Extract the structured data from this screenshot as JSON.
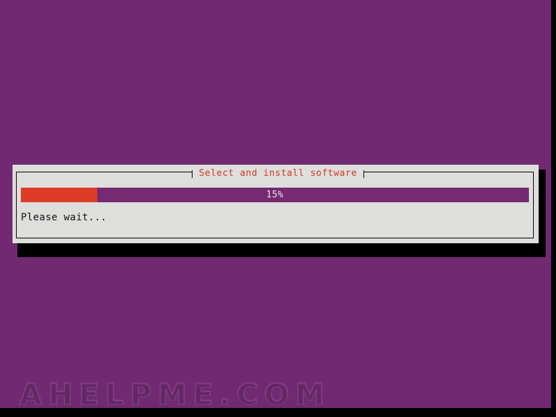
{
  "screen": {
    "background_color": "#712a72",
    "gutter_color": "#000000",
    "watermark": "AHELPME.COM"
  },
  "dialog": {
    "title": "Select and install software",
    "title_color": "#cc3a2a",
    "background_color": "#dededc",
    "border_color": "#000000",
    "shadow_color": "#000000",
    "status_text": "Please wait...",
    "progress": {
      "percent_label": "15%",
      "percent_value": 15,
      "fill_color": "#dd3c26",
      "track_color": "#762a72",
      "label_color": "#e8e8e8"
    }
  }
}
